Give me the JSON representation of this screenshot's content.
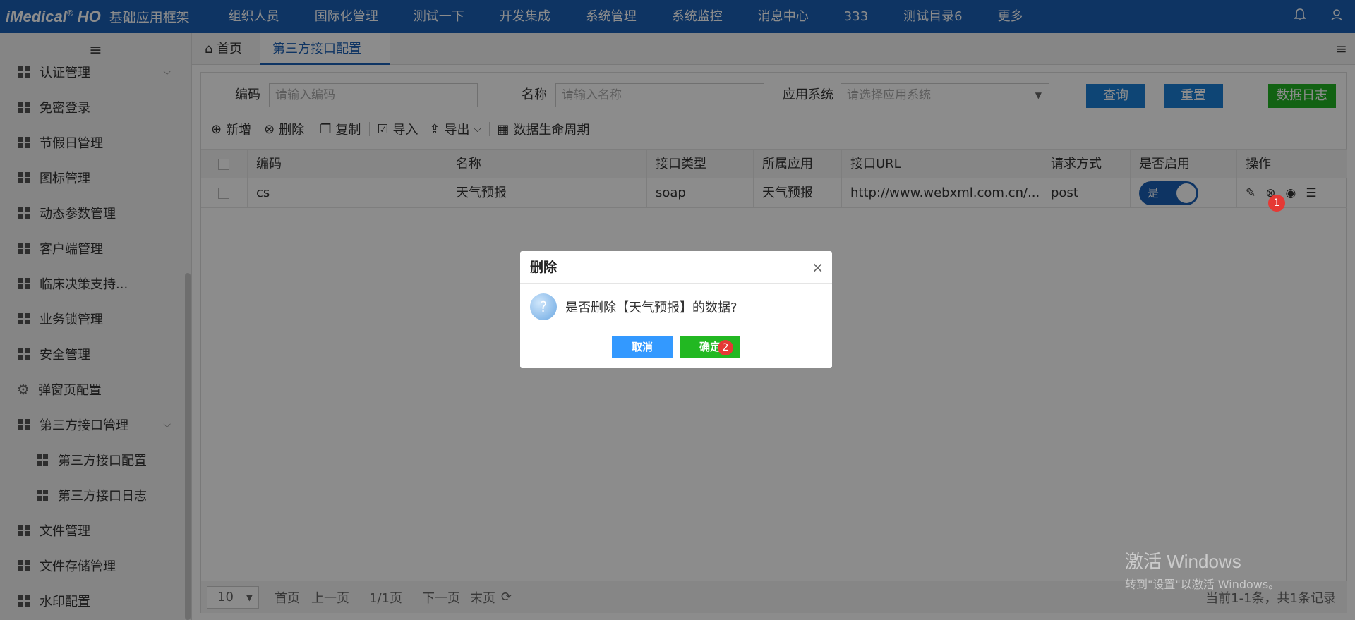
{
  "topbar": {
    "logo": "iMedical",
    "logo_reg": "®",
    "logo_suffix": "HO",
    "app_name": "基础应用框架",
    "nav": [
      "组织人员",
      "国际化管理",
      "测试一下",
      "开发集成",
      "系统管理",
      "系统监控",
      "消息中心",
      "333",
      "测试目录6",
      "更多"
    ],
    "icons": [
      "bell-icon",
      "user-icon"
    ]
  },
  "sidebar": {
    "menu_icon": "≡",
    "items": [
      {
        "label": "认证管理",
        "icon": "grid-icon",
        "expand": "⌵"
      },
      {
        "label": "免密登录",
        "icon": "grid-icon"
      },
      {
        "label": "节假日管理",
        "icon": "grid-icon"
      },
      {
        "label": "图标管理",
        "icon": "grid-icon"
      },
      {
        "label": "动态参数管理",
        "icon": "grid-icon"
      },
      {
        "label": "客户端管理",
        "icon": "grid-icon"
      },
      {
        "label": "临床决策支持...",
        "icon": "grid-icon"
      },
      {
        "label": "业务锁管理",
        "icon": "grid-icon"
      },
      {
        "label": "安全管理",
        "icon": "grid-icon"
      },
      {
        "label": "弹窗页配置",
        "icon": "gear-icon"
      },
      {
        "label": "第三方接口管理",
        "icon": "grid-icon",
        "expand": "⌵"
      },
      {
        "label": "第三方接口配置",
        "icon": "grid-icon",
        "sub": true
      },
      {
        "label": "第三方接口日志",
        "icon": "grid-icon",
        "sub": true
      },
      {
        "label": "文件管理",
        "icon": "grid-icon"
      },
      {
        "label": "文件存储管理",
        "icon": "grid-icon"
      },
      {
        "label": "水印配置",
        "icon": "grid-icon"
      }
    ]
  },
  "tabs": {
    "home": "首页",
    "active": "第三方接口配置",
    "close": "×",
    "menu": "≡"
  },
  "search": {
    "code_label": "编码",
    "code_placeholder": "请输入编码",
    "name_label": "名称",
    "name_placeholder": "请输入名称",
    "app_label": "应用系统",
    "app_placeholder": "请选择应用系统",
    "query": "查询",
    "reset": "重置",
    "log": "数据日志"
  },
  "toolbar": {
    "add": "新增",
    "delete": "删除",
    "copy": "复制",
    "import": "导入",
    "export": "导出",
    "lifecycle": "数据生命周期"
  },
  "table": {
    "headers": [
      "编码",
      "名称",
      "接口类型",
      "所属应用",
      "接口URL",
      "请求方式",
      "是否启用",
      "操作"
    ],
    "rows": [
      {
        "code": "cs",
        "name": "天气预报",
        "type": "soap",
        "app": "天气预报",
        "url": "http://www.webxml.com.cn/...",
        "method": "post",
        "enabled": "是"
      }
    ]
  },
  "pager": {
    "size": "10",
    "first": "首页",
    "prev": "上一页",
    "page": "1/1页",
    "next": "下一页",
    "last": "末页",
    "refresh": "⟳",
    "total": "当前1-1条，共1条记录"
  },
  "modal": {
    "title": "删除",
    "close": "×",
    "question_icon": "?",
    "message": "是否删除【天气预报】的数据?",
    "cancel": "取消",
    "ok": "确定"
  },
  "badges": [
    "1",
    "2"
  ],
  "watermark": {
    "line1": "激活 Windows",
    "line2": "转到\"设置\"以激活 Windows。"
  }
}
